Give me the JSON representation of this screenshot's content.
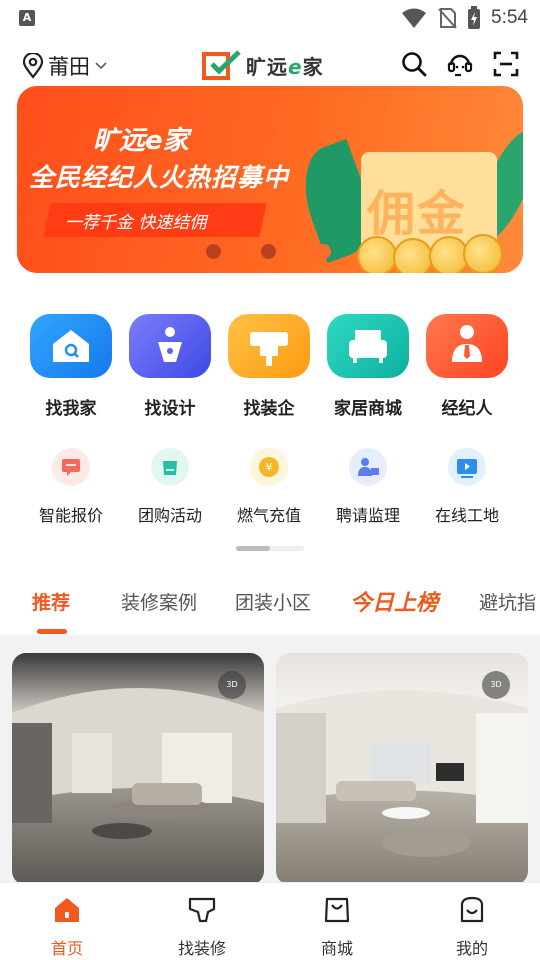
{
  "status_bar": {
    "time": "5:54",
    "app_badge": "A"
  },
  "header": {
    "city": "莆田",
    "logo_text_pre": "旷远",
    "logo_text_e": "e",
    "logo_text_post": "家"
  },
  "banner": {
    "line1": "旷远e家",
    "line2": "全民经纪人火热招募中",
    "slogan": "一荐千金 快速结佣",
    "card_text": "佣金",
    "slide_count": 3,
    "active_slide": 3
  },
  "main_nav": [
    {
      "label": "找我家",
      "icon": "house-search-icon",
      "color": "#1f8ff5"
    },
    {
      "label": "找设计",
      "icon": "pen-nib-icon",
      "color": "#5a63f2"
    },
    {
      "label": "找装企",
      "icon": "paint-roller-icon",
      "color": "#ffab1f"
    },
    {
      "label": "家居商城",
      "icon": "sofa-icon",
      "color": "#17c1b2"
    },
    {
      "label": "经纪人",
      "icon": "agent-icon",
      "color": "#ff5b32"
    }
  ],
  "sub_nav": [
    {
      "label": "智能报价",
      "icon": "quote-icon",
      "color": "#f36a5a"
    },
    {
      "label": "团购活动",
      "icon": "group-buy-icon",
      "color": "#22c1a3"
    },
    {
      "label": "燃气充值",
      "icon": "gas-coin-icon",
      "color": "#f5b62a"
    },
    {
      "label": "聘请监理",
      "icon": "supervisor-icon",
      "color": "#5b7df0"
    },
    {
      "label": "在线工地",
      "icon": "video-site-icon",
      "color": "#2a8ff0"
    }
  ],
  "tabs": [
    {
      "label": "推荐",
      "active": true
    },
    {
      "label": "装修案例"
    },
    {
      "label": "团装小区"
    },
    {
      "label": "今日上榜",
      "hot": true
    },
    {
      "label": "避坑指"
    }
  ],
  "feed_cards": [
    {
      "badge": "3D"
    },
    {
      "badge": "3D"
    }
  ],
  "bottom_nav": [
    {
      "label": "首页",
      "active": true,
      "icon": "home-icon"
    },
    {
      "label": "找装修",
      "icon": "shirt-icon"
    },
    {
      "label": "商城",
      "icon": "shopping-bag-icon"
    },
    {
      "label": "我的",
      "icon": "smile-bag-icon"
    }
  ],
  "colors": {
    "accent": "#f05a1e",
    "banner": "#ff5a1f"
  }
}
